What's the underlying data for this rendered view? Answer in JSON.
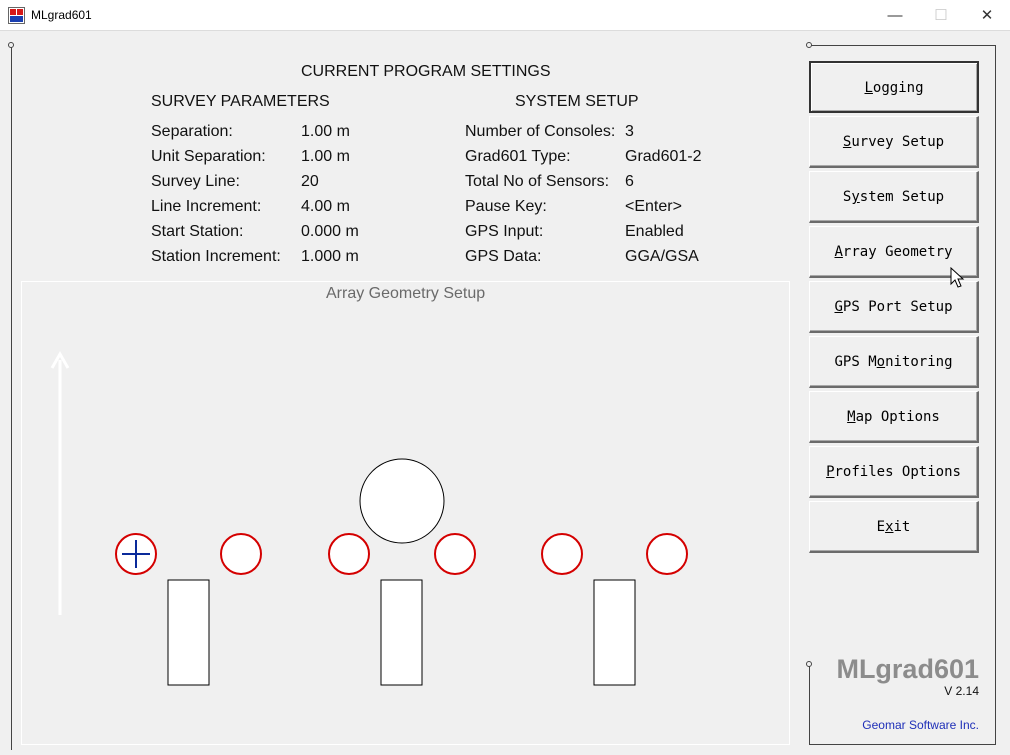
{
  "window": {
    "title": "MLgrad601",
    "minimize_glyph": "—",
    "maximize_glyph": "☐",
    "close_glyph": "✕"
  },
  "settings": {
    "title": "CURRENT PROGRAM SETTINGS",
    "survey": {
      "heading": "SURVEY PARAMETERS",
      "rows": [
        {
          "label": "Separation:",
          "value": "1.00 m"
        },
        {
          "label": "Unit Separation:",
          "value": "1.00 m"
        },
        {
          "label": "Survey Line:",
          "value": "20"
        },
        {
          "label": "Line Increment:",
          "value": "4.00 m"
        },
        {
          "label": "Start Station:",
          "value": "0.000 m"
        },
        {
          "label": "Station Increment:",
          "value": "1.000 m"
        }
      ]
    },
    "system": {
      "heading": "SYSTEM SETUP",
      "rows": [
        {
          "label": "Number of Consoles:",
          "value": "3"
        },
        {
          "label": "Grad601 Type:",
          "value": "Grad601-2"
        },
        {
          "label": "Total No of Sensors:",
          "value": "6"
        },
        {
          "label": "Pause Key:",
          "value": "<Enter>"
        },
        {
          "label": "GPS Input:",
          "value": "Enabled"
        },
        {
          "label": "GPS Data:",
          "value": "GGA/GSA"
        }
      ]
    }
  },
  "array_geometry": {
    "title": "Array Geometry Setup",
    "sensor_color": "#d40000",
    "marker_color": "#0a2a9a",
    "consoles": 3,
    "sensors": 6
  },
  "buttons": [
    {
      "label": "Logging",
      "hotkey": "L",
      "focused": true
    },
    {
      "label": "Survey Setup",
      "hotkey": "S"
    },
    {
      "label": "System Setup",
      "hotkey": "y"
    },
    {
      "label": "Array Geometry",
      "hotkey": "A"
    },
    {
      "label": "GPS Port Setup",
      "hotkey": "G"
    },
    {
      "label": "GPS Monitoring",
      "hotkey": "o"
    },
    {
      "label": "Map Options",
      "hotkey": "M"
    },
    {
      "label": "Profiles Options",
      "hotkey": "P"
    },
    {
      "label": "Exit",
      "hotkey": "x"
    }
  ],
  "branding": {
    "name": "MLgrad601",
    "version": "V 2.14",
    "company": "Geomar Software Inc."
  }
}
